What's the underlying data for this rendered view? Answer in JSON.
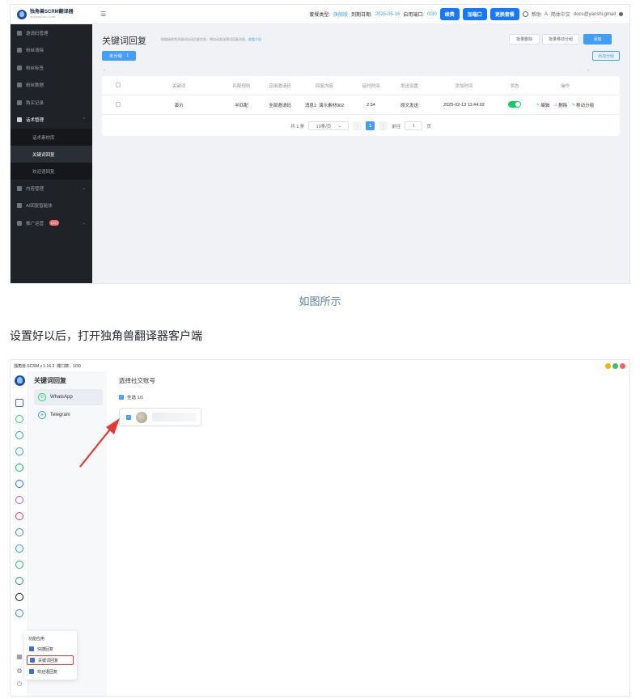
{
  "shot1": {
    "logo": {
      "title": "独角兽SCRM翻译器",
      "subtitle": "dujiaoshou.com"
    },
    "topbar": {
      "package_label": "套餐类型:",
      "package_value": "旗舰版",
      "expire_label": "到期日期:",
      "expire_value": "2025-05-16",
      "ports_label": "启用端口:",
      "ports_value": "0/30",
      "btn_renew": "续费",
      "btn_add_port": "加端口",
      "btn_change_plan": "更换套餐",
      "help": "帮助",
      "language": "简体中文",
      "user": "docs@yanshi.gmail"
    },
    "sidebar": {
      "items": [
        {
          "label": "邀请码管理"
        },
        {
          "label": "粉丝清除"
        },
        {
          "label": "粉丝标签"
        },
        {
          "label": "粉丝数据"
        },
        {
          "label": "购买记录"
        },
        {
          "label": "话术管理"
        }
      ],
      "sub_items": [
        {
          "label": "话术素材库"
        },
        {
          "label": "关键词回复"
        },
        {
          "label": "欢迎语回复"
        }
      ],
      "items_after": [
        {
          "label": "内容管理"
        },
        {
          "label": "AI回复智能体"
        },
        {
          "label": "推广运营",
          "badge": "HOT"
        }
      ]
    },
    "page": {
      "title": "关键词回复",
      "desc": "根据接收到关键词自动回复信息，将自动发送预设回复消息。",
      "desc_link": "查看介绍",
      "btn_batch_delete": "批量删除",
      "btn_batch_move": "批量移动分组",
      "btn_add": "添加",
      "group_tag": "未分组",
      "group_count": "1",
      "btn_add_group": "添加分组"
    },
    "table": {
      "headers": [
        "关键词",
        "匹配规则",
        "应用邀请码",
        "回复内容",
        "延时时间",
        "发送设置",
        "添加时间",
        "状态",
        "操作"
      ],
      "rows": [
        {
          "keyword": "演示",
          "rule": "半匹配",
          "code": "全部邀请码",
          "content": "消息1: 演示素材002",
          "delay": "2,54",
          "send": "原文发送",
          "time": "2025-02-13 11:44:02",
          "status_on": true
        }
      ],
      "actions": {
        "edit": "编辑",
        "delete": "删除",
        "move": "移动分组"
      }
    },
    "pagination": {
      "total": "共 1 条",
      "page_size": "10条/页",
      "current": "1",
      "goto_label": "前往",
      "goto_value": "1",
      "page_unit": "页"
    }
  },
  "caption": "如图所示",
  "paragraph": "设置好以后，打开独角兽翻译器客户端",
  "shot2": {
    "app_title": "独角兽 SCRM v 1.16.3",
    "ports": "端口数：1/30",
    "panel_title": "关键词回复",
    "accounts": [
      {
        "label": "WhatsApp",
        "color": "#25d366"
      },
      {
        "label": "Telegram",
        "color": "#2aa3df"
      }
    ],
    "content_title": "选择社交账号",
    "select_all": "全选 1/1",
    "popup": {
      "title": "功能应用",
      "items": [
        {
          "label": "快捷回复"
        },
        {
          "label": "关键词回复"
        },
        {
          "label": "欢迎语回复"
        }
      ]
    },
    "colors": {
      "accent": "#409eff",
      "arrow": "#e53935",
      "highlight": "#e53935"
    }
  }
}
